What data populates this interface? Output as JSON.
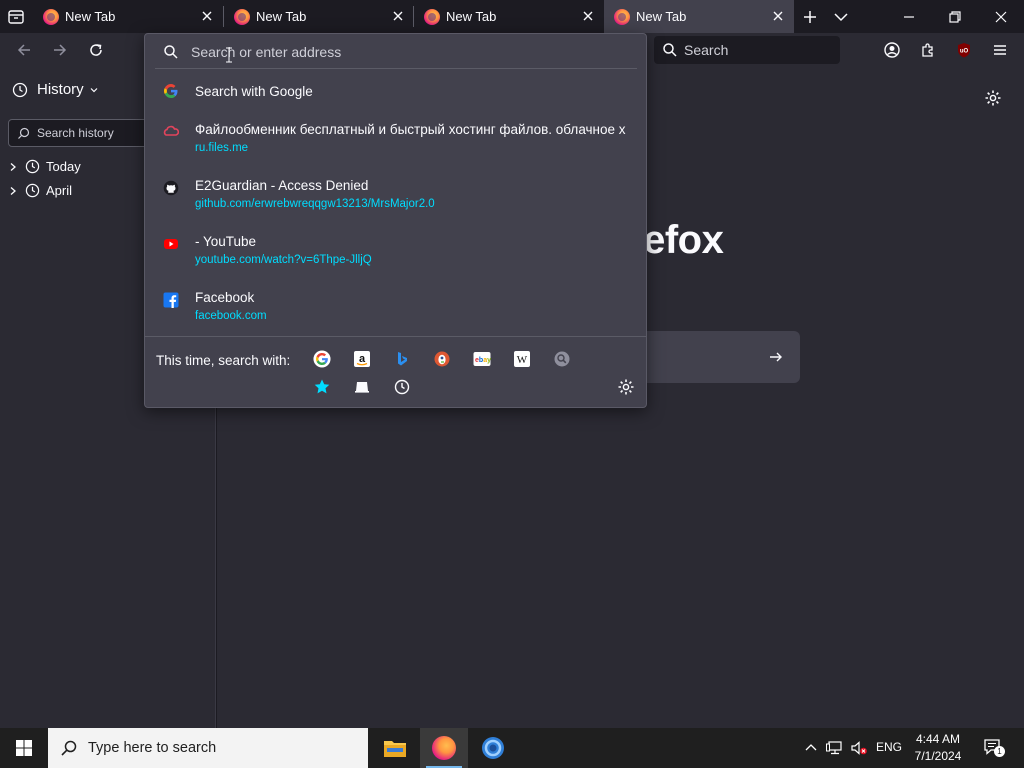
{
  "browser": {
    "tabs": [
      {
        "label": "New Tab",
        "active": false
      },
      {
        "label": "New Tab",
        "active": false
      },
      {
        "label": "New Tab",
        "active": false
      },
      {
        "label": "New Tab",
        "active": true
      }
    ],
    "search_placeholder": "Search"
  },
  "sidebar": {
    "title": "History",
    "search_placeholder": "Search history",
    "groups": [
      {
        "label": "Today"
      },
      {
        "label": "April"
      }
    ]
  },
  "content": {
    "wordmark": "refox"
  },
  "urlbar": {
    "placeholder": "Search or enter address",
    "results": [
      {
        "title": "Search with Google",
        "url": "",
        "icon": "google-icon"
      },
      {
        "title": "Файлообменник бесплатный и быстрый хостинг файлов. облачное х",
        "url": "ru.files.me",
        "icon": "cloud-icon"
      },
      {
        "title": "E2Guardian - Access Denied",
        "url": "github.com/erwrebwreqqgw13213/MrsMajor2.0",
        "icon": "github-icon"
      },
      {
        "title": "- YouTube",
        "url": "youtube.com/watch?v=6Thpe-JlljQ",
        "icon": "youtube-icon"
      },
      {
        "title": "Facebook",
        "url": "facebook.com",
        "icon": "facebook-icon"
      }
    ],
    "engines_label": "This time, search with:",
    "engines": [
      "google-icon",
      "amazon-icon",
      "bing-icon",
      "duckduckgo-icon",
      "ebay-icon",
      "wikipedia-icon",
      "search-engine-icon",
      "bookmarks-icon",
      "tabs-icon",
      "history-icon"
    ]
  },
  "taskbar": {
    "search_placeholder": "Type here to search",
    "language": "ENG",
    "time": "4:44 AM",
    "date": "7/1/2024",
    "notification_count": "1"
  },
  "colors": {
    "accent_link": "#00ddff",
    "dropdown_bg": "#42414d",
    "chrome_bg": "#2b2a33",
    "tab_bg": "#1c1b22"
  }
}
